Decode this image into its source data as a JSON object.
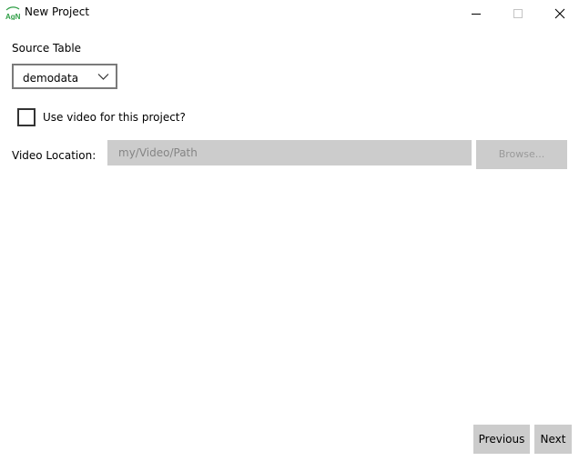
{
  "window": {
    "title": "New Project",
    "app_icon": "agn-logo-icon",
    "controls": [
      "minimize-icon",
      "maximize-icon",
      "close-icon"
    ]
  },
  "form": {
    "source_table_label": "Source Table",
    "source_table_value": "demodata",
    "use_video_label": "Use video for this project?",
    "use_video_checked": false,
    "video_location_label": "Video Location:",
    "video_location_value": "my/Video/Path",
    "video_location_enabled": false,
    "browse_label": "Browse...",
    "browse_enabled": false
  },
  "footer": {
    "previous_label": "Previous",
    "next_label": "Next"
  },
  "colors": {
    "disabled_bg": "#cccccc",
    "disabled_text": "#858585",
    "icon_green": "#2e9e45"
  }
}
